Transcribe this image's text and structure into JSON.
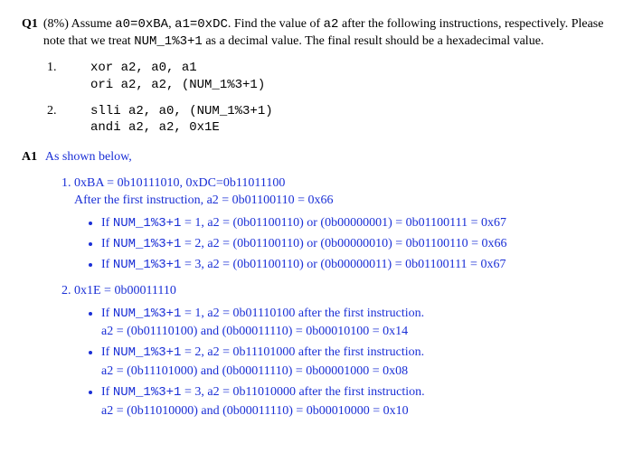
{
  "question": {
    "label": "Q1",
    "percent": "(8%)",
    "line1a": "Assume ",
    "code1": "a0=0xBA",
    "sep1": ", ",
    "code2": "a1=0xDC",
    "line1b": ". Find the value of ",
    "code3": "a2",
    "line1c": " after the following instructions, respectively. Please note that we treat ",
    "code4": "NUM_1%3+1",
    "line1d": " as a decimal value. The final result should be a hexadecimal value."
  },
  "instructions": [
    {
      "num": "1.",
      "l1": "xor a2, a0, a1",
      "l2": "ori a2, a2, (NUM_1%3+1)"
    },
    {
      "num": "2.",
      "l1": "slli a2, a0, (NUM_1%3+1)",
      "l2": "andi a2, a2, 0x1E"
    }
  ],
  "answer": {
    "label": "A1",
    "intro": "As shown below,",
    "part1": {
      "header": "0xBA = 0b10111010, 0xDC=0b11011100",
      "after": "After the first instruction, a2 = 0b01100110 = 0x66",
      "bullets": [
        {
          "pre": "If ",
          "num": "NUM_1%3+1",
          "rest": " = 1, a2 = (0b01100110) or (0b00000001) = 0b01100111 = 0x67"
        },
        {
          "pre": "If ",
          "num": "NUM_1%3+1",
          "rest": " = 2, a2 = (0b01100110) or (0b00000010) = 0b01100110 = 0x66"
        },
        {
          "pre": "If ",
          "num": "NUM_1%3+1",
          "rest": " = 3, a2 = (0b01100110) or (0b00000011) = 0b01100111 = 0x67"
        }
      ]
    },
    "part2": {
      "header": "0x1E = 0b00011110",
      "bullets": [
        {
          "pre": "If ",
          "num": "NUM_1%3+1",
          "rest": " = 1, a2 = 0b01110100 after the first instruction.",
          "sub": "a2 = (0b01110100) and (0b00011110) = 0b00010100 = 0x14"
        },
        {
          "pre": "If ",
          "num": "NUM_1%3+1",
          "rest": " = 2, a2 = 0b11101000 after the first instruction.",
          "sub": "a2 = (0b11101000) and (0b00011110) = 0b00001000 = 0x08"
        },
        {
          "pre": "If ",
          "num": "NUM_1%3+1",
          "rest": " = 3, a2 = 0b11010000 after the first instruction.",
          "sub": "a2 = (0b11010000) and (0b00011110) = 0b00010000 = 0x10"
        }
      ]
    }
  }
}
